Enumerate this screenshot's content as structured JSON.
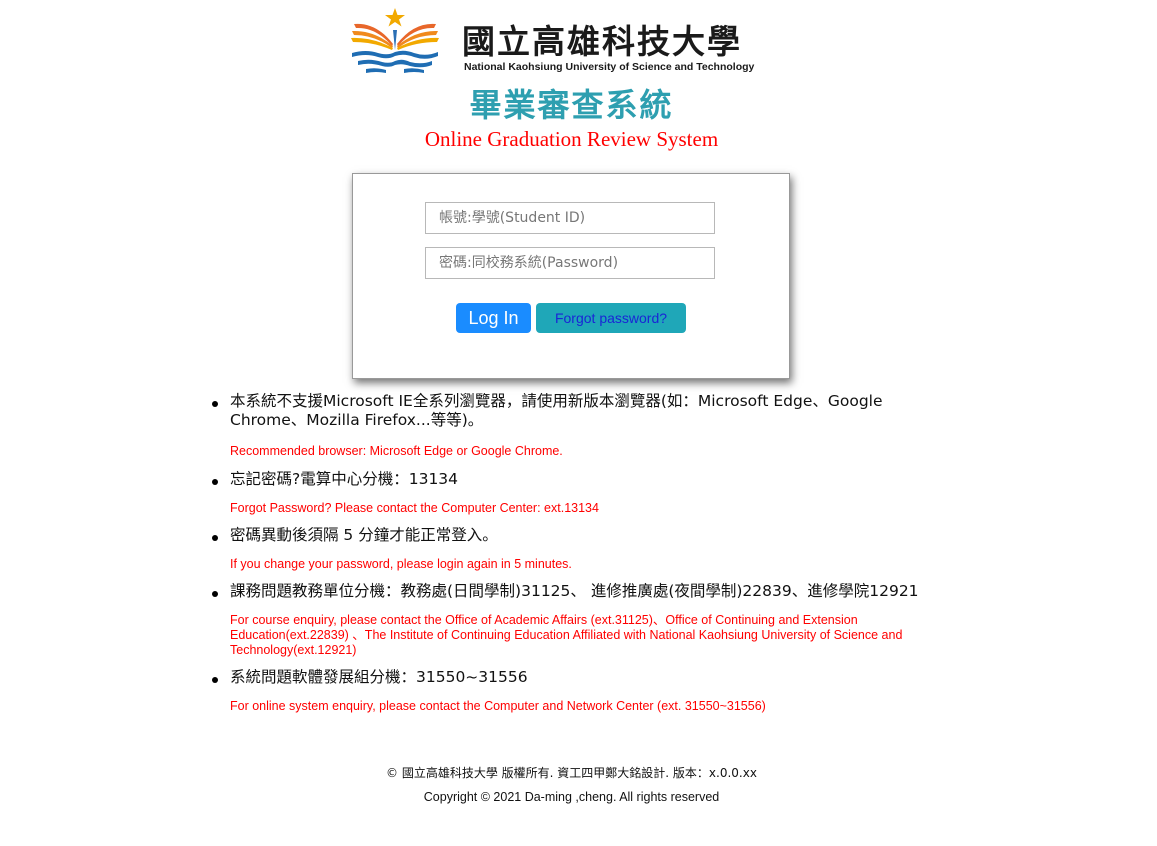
{
  "header": {
    "logo_cn": "國立高雄科技大學",
    "logo_en": "National Kaohsiung University of Science and Technology",
    "title_cn": "畢業審查系統",
    "title_en": "Online Graduation Review System"
  },
  "login": {
    "username_placeholder": "帳號:學號(Student ID)",
    "username_value": "",
    "password_placeholder": "密碼:同校務系統(Password)",
    "password_value": "",
    "login_button": "Log In",
    "forgot_button": "Forgot password?"
  },
  "notices": [
    {
      "main": "本系統不支援Microsoft IE全系列瀏覽器，請使用新版本瀏覽器(如：Microsoft Edge、Google Chrome、Mozilla Firefox...等等)。",
      "sub": "Recommended browser: Microsoft Edge or Google Chrome."
    },
    {
      "main": "忘記密碼?電算中心分機：13134",
      "sub": "Forgot Password? Please contact the Computer Center: ext.13134"
    },
    {
      "main": "密碼異動後須隔 5 分鐘才能正常登入。",
      "sub": "If you change your password, please login again in 5 minutes."
    },
    {
      "main": "課務問題教務單位分機：教務處(日間學制)31125、 進修推廣處(夜間學制)22839、進修學院12921",
      "sub": "For course enquiry, please contact the Office of Academic Affairs (ext.31125)、Office of Continuing and Extension Education(ext.22839) 、The Institute of Continuing Education Affiliated with National Kaohsiung University of Science and Technology(ext.12921)"
    },
    {
      "main": "系統問題軟體發展組分機：31550~31556",
      "sub": "For online system enquiry, please contact the Computer and Network Center (ext. 31550~31556)"
    }
  ],
  "footer": {
    "line_cn": "© 國立高雄科技大學 版權所有. 資工四甲鄭大銘設計. 版本：x.0.0.xx",
    "line_en": "Copyright © 2021 Da-ming ,cheng. All rights reserved"
  },
  "colors": {
    "title_teal": "#2e9fb0",
    "subtitle_red": "#ff0000",
    "login_blue": "#1a8cff",
    "forgot_teal": "#1fa7b8"
  },
  "icons": {
    "logo_mark": "university-book-star-logo-icon"
  }
}
